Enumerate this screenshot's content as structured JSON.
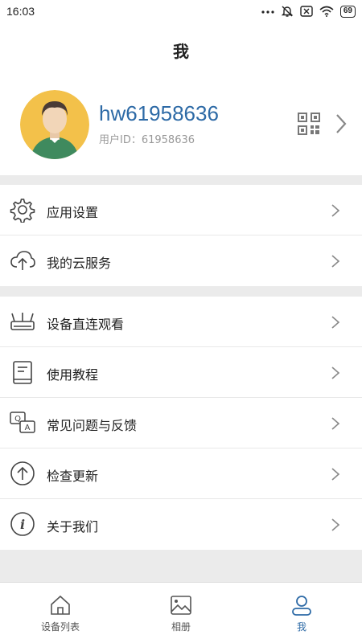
{
  "status": {
    "time": "16:03",
    "battery": "69"
  },
  "header": {
    "title": "我"
  },
  "profile": {
    "username": "hw61958636",
    "user_id": "用户ID：61958636"
  },
  "section1": [
    {
      "label": "应用设置",
      "icon": "gear-icon"
    },
    {
      "label": "我的云服务",
      "icon": "cloud-upload-icon"
    }
  ],
  "section2": [
    {
      "label": "设备直连观看",
      "icon": "router-icon"
    },
    {
      "label": "使用教程",
      "icon": "book-icon"
    },
    {
      "label": "常见问题与反馈",
      "icon": "qa-icon"
    },
    {
      "label": "检查更新",
      "icon": "arrow-up-circle-icon"
    },
    {
      "label": "关于我们",
      "icon": "info-icon"
    }
  ],
  "tabs": [
    {
      "label": "设备列表",
      "icon": "home-icon"
    },
    {
      "label": "相册",
      "icon": "image-icon"
    },
    {
      "label": "我",
      "icon": "person-icon",
      "active": true
    }
  ],
  "colors": {
    "accent": "#2d6aa6",
    "background": "#ebebeb"
  }
}
